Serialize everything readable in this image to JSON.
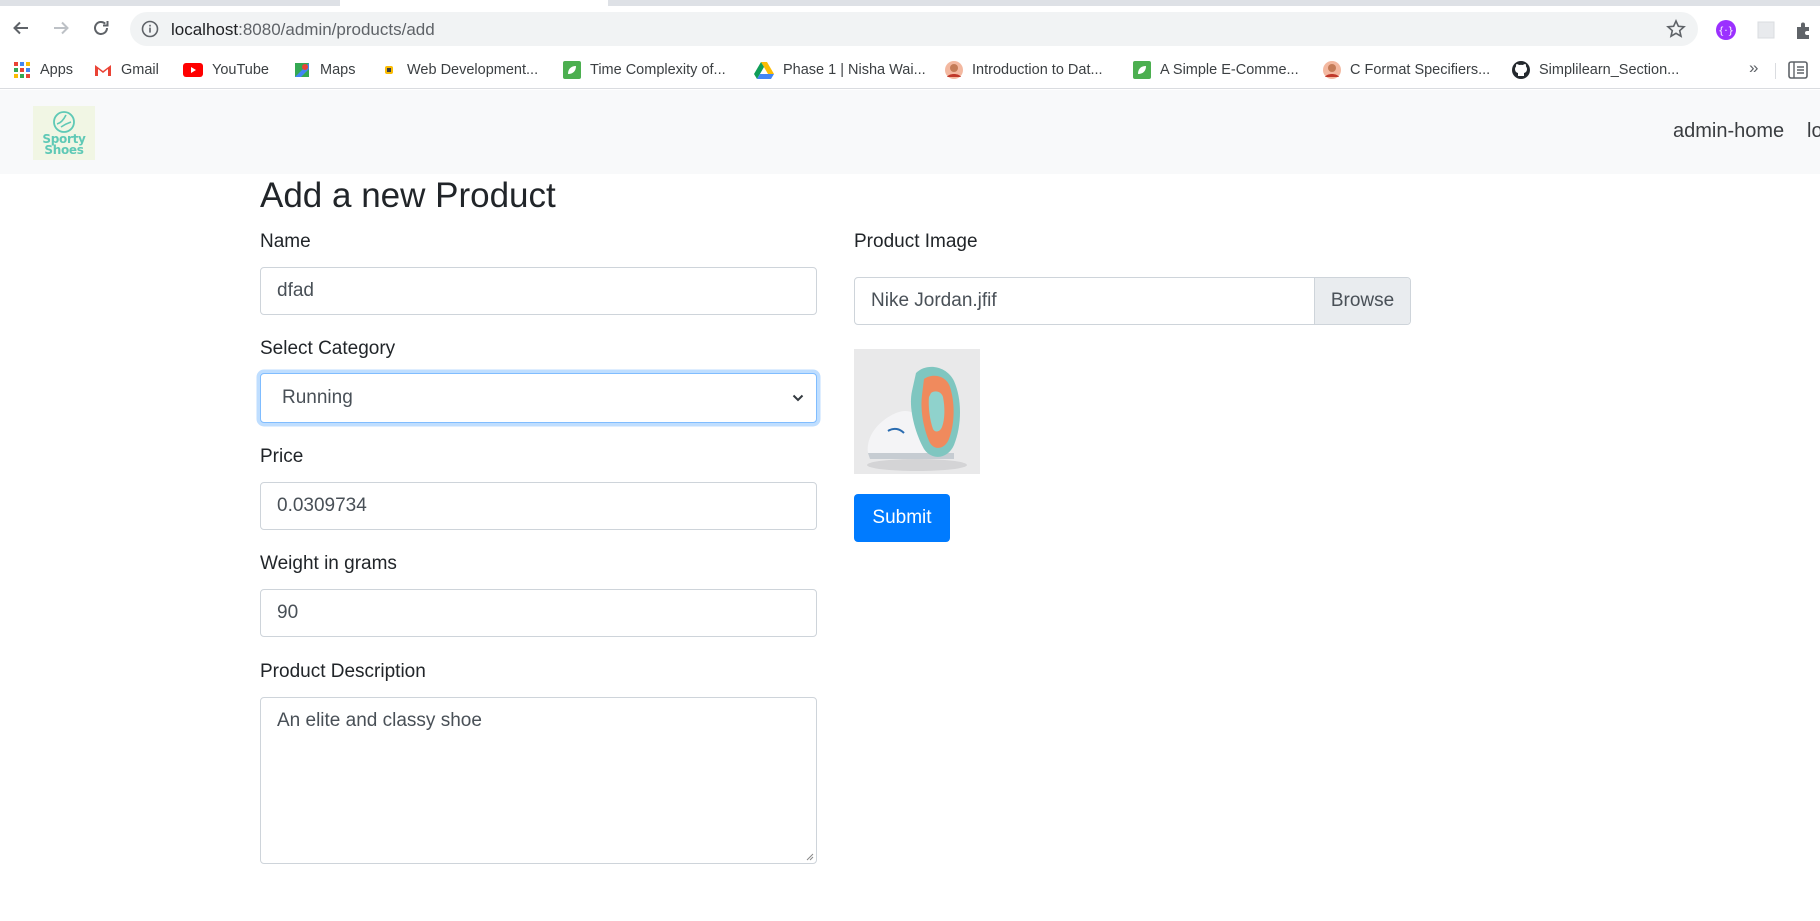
{
  "browser": {
    "url_host": "localhost",
    "url_rest": ":8080/admin/products/add",
    "bookmarks": [
      {
        "label": "Apps",
        "icon": "apps-grid-icon"
      },
      {
        "label": "Gmail",
        "icon": "gmail-icon"
      },
      {
        "label": "YouTube",
        "icon": "youtube-icon"
      },
      {
        "label": "Maps",
        "icon": "maps-icon"
      },
      {
        "label": "Web Development...",
        "icon": "web-dev-icon"
      },
      {
        "label": "Time Complexity of...",
        "icon": "leaf-icon"
      },
      {
        "label": "Phase 1 | Nisha Wai...",
        "icon": "drive-icon"
      },
      {
        "label": "Introduction to Dat...",
        "icon": "avatar-icon"
      },
      {
        "label": "A Simple E-Comme...",
        "icon": "leaf-icon"
      },
      {
        "label": "C Format Specifiers...",
        "icon": "avatar-icon"
      },
      {
        "label": "Simplilearn_Section...",
        "icon": "github-icon"
      }
    ],
    "more_label": "»"
  },
  "navbar": {
    "logo_line1": "Sporty",
    "logo_line2": "Shoes",
    "links": [
      "admin-home",
      "lo"
    ]
  },
  "form": {
    "title": "Add a new Product",
    "name_label": "Name",
    "name_value": "dfad",
    "category_label": "Select Category",
    "category_value": "Running",
    "price_label": "Price",
    "price_value": "0.0309734",
    "weight_label": "Weight in grams",
    "weight_value": "90",
    "description_label": "Product Description",
    "description_value": "An elite and classy shoe",
    "image_label": "Product Image",
    "image_file": "Nike Jordan.jfif",
    "browse_label": "Browse",
    "submit_label": "Submit"
  },
  "colors": {
    "primary": "#007bff",
    "navbar_bg": "#f8f9fa",
    "logo_teal": "#5fc9b6"
  }
}
